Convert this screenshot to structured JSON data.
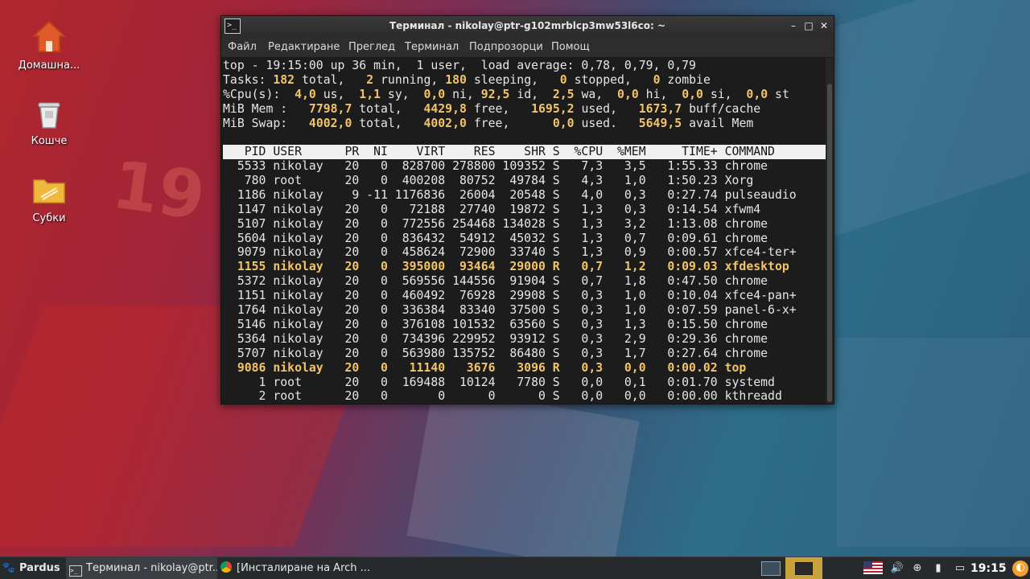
{
  "desktop": {
    "icons": [
      {
        "label": "Домашна...",
        "icon": "home-folder-icon"
      },
      {
        "label": "Кошче",
        "icon": "trash-icon"
      },
      {
        "label": "Субки",
        "icon": "folder-icon"
      }
    ]
  },
  "window": {
    "title": "Терминал - nikolay@ptr-g102mrblcp3mw53l6co: ~",
    "menu": [
      "Файл",
      "Редактиране",
      "Преглед",
      "Терминал",
      "Подпрозорци",
      "Помощ"
    ]
  },
  "top": {
    "summary": {
      "line1": "top - 19:15:00 up 36 min,  1 user,  load average: 0,78, 0,79, 0,79",
      "tasks": {
        "total": "182",
        "running": "2",
        "sleeping": "180",
        "stopped": "0",
        "zombie": "0"
      },
      "cpu": {
        "us": "4,0",
        "sy": "1,1",
        "ni": "0,0",
        "id": "92,5",
        "wa": "2,5",
        "hi": "0,0",
        "si": "0,0",
        "st": "0,0"
      },
      "mem": {
        "total": "7798,7",
        "free": "4429,8",
        "used": "1695,2",
        "buff_cache": "1673,7"
      },
      "swap": {
        "total": "4002,0",
        "free": "4002,0",
        "used": "0,0",
        "avail_mem": "5649,5"
      }
    },
    "columns": [
      "PID",
      "USER",
      "PR",
      "NI",
      "VIRT",
      "RES",
      "SHR",
      "S",
      "%CPU",
      "%MEM",
      "TIME+",
      "COMMAND"
    ],
    "processes": [
      {
        "pid": "5533",
        "user": "nikolay",
        "pr": "20",
        "ni": "0",
        "virt": "828700",
        "res": "278800",
        "shr": "109352",
        "s": "S",
        "cpu": "7,3",
        "mem": "3,5",
        "time": "1:55.33",
        "command": "chrome",
        "highlight": false
      },
      {
        "pid": "780",
        "user": "root",
        "pr": "20",
        "ni": "0",
        "virt": "400208",
        "res": "80752",
        "shr": "49784",
        "s": "S",
        "cpu": "4,3",
        "mem": "1,0",
        "time": "1:50.23",
        "command": "Xorg",
        "highlight": false
      },
      {
        "pid": "1186",
        "user": "nikolay",
        "pr": "9",
        "ni": "-11",
        "virt": "1176836",
        "res": "26004",
        "shr": "20548",
        "s": "S",
        "cpu": "4,0",
        "mem": "0,3",
        "time": "0:27.74",
        "command": "pulseaudio",
        "highlight": false
      },
      {
        "pid": "1147",
        "user": "nikolay",
        "pr": "20",
        "ni": "0",
        "virt": "72188",
        "res": "27740",
        "shr": "19872",
        "s": "S",
        "cpu": "1,3",
        "mem": "0,3",
        "time": "0:14.54",
        "command": "xfwm4",
        "highlight": false
      },
      {
        "pid": "5107",
        "user": "nikolay",
        "pr": "20",
        "ni": "0",
        "virt": "772556",
        "res": "254468",
        "shr": "134028",
        "s": "S",
        "cpu": "1,3",
        "mem": "3,2",
        "time": "1:13.08",
        "command": "chrome",
        "highlight": false
      },
      {
        "pid": "5604",
        "user": "nikolay",
        "pr": "20",
        "ni": "0",
        "virt": "836432",
        "res": "54912",
        "shr": "45032",
        "s": "S",
        "cpu": "1,3",
        "mem": "0,7",
        "time": "0:09.61",
        "command": "chrome",
        "highlight": false
      },
      {
        "pid": "9079",
        "user": "nikolay",
        "pr": "20",
        "ni": "0",
        "virt": "458624",
        "res": "72900",
        "shr": "33740",
        "s": "S",
        "cpu": "1,3",
        "mem": "0,9",
        "time": "0:00.57",
        "command": "xfce4-ter+",
        "highlight": false
      },
      {
        "pid": "1155",
        "user": "nikolay",
        "pr": "20",
        "ni": "0",
        "virt": "395000",
        "res": "93464",
        "shr": "29000",
        "s": "R",
        "cpu": "0,7",
        "mem": "1,2",
        "time": "0:09.03",
        "command": "xfdesktop",
        "highlight": true
      },
      {
        "pid": "5372",
        "user": "nikolay",
        "pr": "20",
        "ni": "0",
        "virt": "569556",
        "res": "144556",
        "shr": "91904",
        "s": "S",
        "cpu": "0,7",
        "mem": "1,8",
        "time": "0:47.50",
        "command": "chrome",
        "highlight": false
      },
      {
        "pid": "1151",
        "user": "nikolay",
        "pr": "20",
        "ni": "0",
        "virt": "460492",
        "res": "76928",
        "shr": "29908",
        "s": "S",
        "cpu": "0,3",
        "mem": "1,0",
        "time": "0:10.04",
        "command": "xfce4-pan+",
        "highlight": false
      },
      {
        "pid": "1764",
        "user": "nikolay",
        "pr": "20",
        "ni": "0",
        "virt": "336384",
        "res": "83340",
        "shr": "37500",
        "s": "S",
        "cpu": "0,3",
        "mem": "1,0",
        "time": "0:07.59",
        "command": "panel-6-x+",
        "highlight": false
      },
      {
        "pid": "5146",
        "user": "nikolay",
        "pr": "20",
        "ni": "0",
        "virt": "376108",
        "res": "101532",
        "shr": "63560",
        "s": "S",
        "cpu": "0,3",
        "mem": "1,3",
        "time": "0:15.50",
        "command": "chrome",
        "highlight": false
      },
      {
        "pid": "5364",
        "user": "nikolay",
        "pr": "20",
        "ni": "0",
        "virt": "734396",
        "res": "229952",
        "shr": "93912",
        "s": "S",
        "cpu": "0,3",
        "mem": "2,9",
        "time": "0:29.36",
        "command": "chrome",
        "highlight": false
      },
      {
        "pid": "5707",
        "user": "nikolay",
        "pr": "20",
        "ni": "0",
        "virt": "563980",
        "res": "135752",
        "shr": "86480",
        "s": "S",
        "cpu": "0,3",
        "mem": "1,7",
        "time": "0:27.64",
        "command": "chrome",
        "highlight": false
      },
      {
        "pid": "9086",
        "user": "nikolay",
        "pr": "20",
        "ni": "0",
        "virt": "11140",
        "res": "3676",
        "shr": "3096",
        "s": "R",
        "cpu": "0,3",
        "mem": "0,0",
        "time": "0:00.02",
        "command": "top",
        "highlight": true
      },
      {
        "pid": "1",
        "user": "root",
        "pr": "20",
        "ni": "0",
        "virt": "169488",
        "res": "10124",
        "shr": "7780",
        "s": "S",
        "cpu": "0,0",
        "mem": "0,1",
        "time": "0:01.70",
        "command": "systemd",
        "highlight": false
      },
      {
        "pid": "2",
        "user": "root",
        "pr": "20",
        "ni": "0",
        "virt": "0",
        "res": "0",
        "shr": "0",
        "s": "S",
        "cpu": "0,0",
        "mem": "0,0",
        "time": "0:00.00",
        "command": "kthreadd",
        "highlight": false
      }
    ]
  },
  "taskbar": {
    "start_label": "Pardus",
    "tasks": [
      {
        "label": "Терминал - nikolay@ptr...",
        "icon": "terminal-icon"
      },
      {
        "label": "[Инсталиране на Arch ...",
        "icon": "chrome-icon"
      }
    ],
    "clock": "19:15"
  },
  "colors": {
    "accent": "#f2c469",
    "panel": "#272a2d",
    "terminal_bg": "#1c1c1c"
  }
}
